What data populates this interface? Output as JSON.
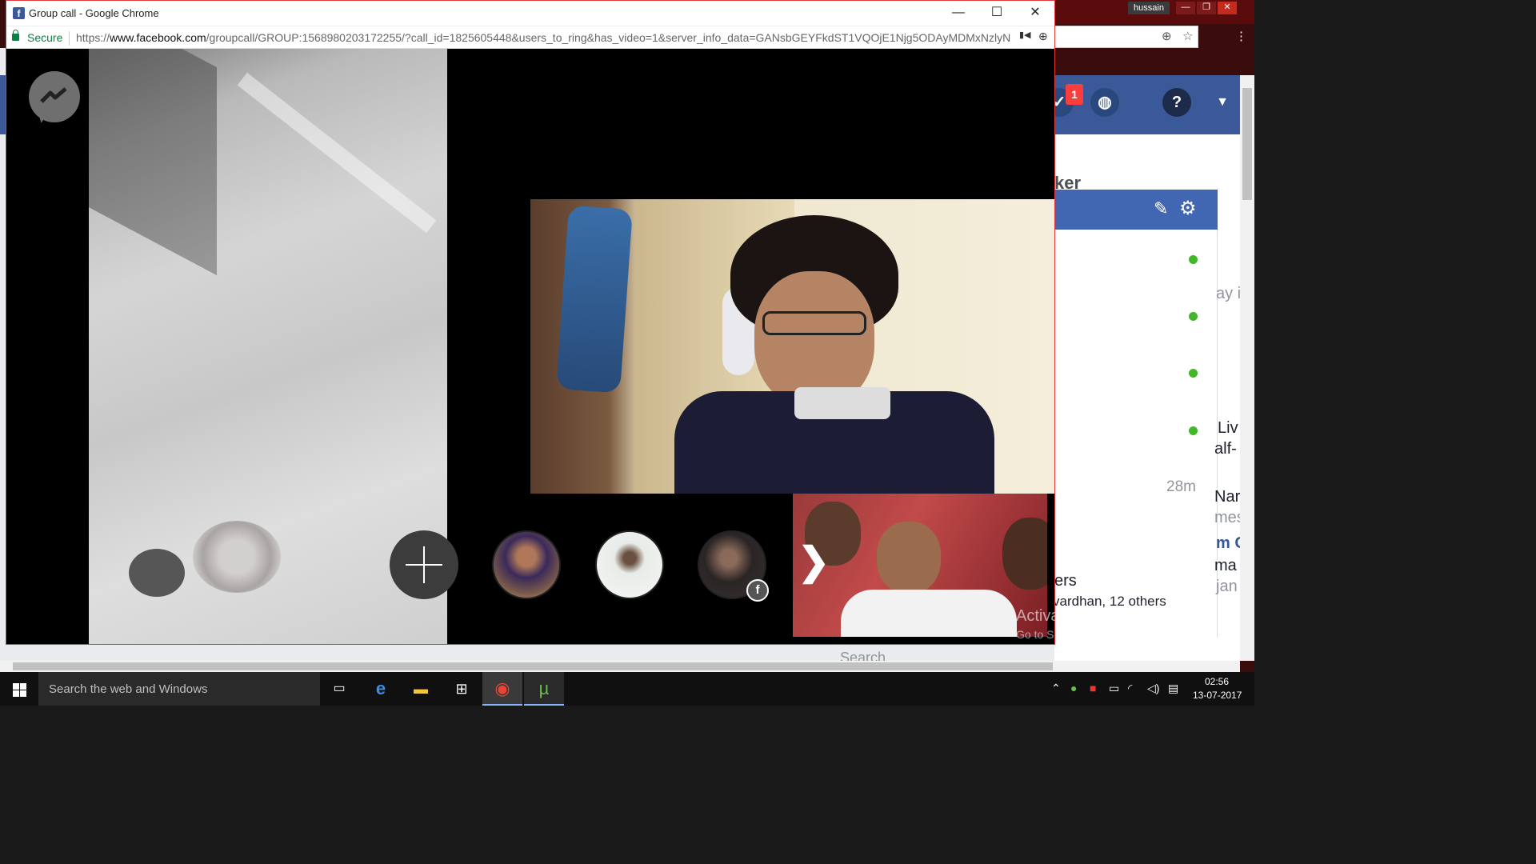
{
  "window": {
    "title": "Group call - Google Chrome",
    "favicon_letter": "f",
    "controls": {
      "minimize": "—",
      "maximize": "☐",
      "close": "✕"
    }
  },
  "address_bar": {
    "secure_label": "Secure",
    "url_scheme": "https://",
    "url_domain": "www.facebook.com",
    "url_path": "/groupcall/GROUP:1568980203172255/?call_id=1825605448&users_to_ring&has_video=1&server_info_data=GANsbGEYFkdST1VQOjE1Njg5ODAyMDMxNzlyN",
    "camera_icon": "▮◀",
    "zoom_icon": "⊕"
  },
  "call": {
    "add_participant_label": "+",
    "participants_fb_badge": "f",
    "next_arrow": "❯",
    "watermark_title": "Activate Windows",
    "watermark_sub": "Go to Settings to activate Windows."
  },
  "background_page": {
    "user_name": "hussain",
    "notification_count": "1",
    "help_icon": "?",
    "ticker_fragment": "ker",
    "snippet_1": "ay i",
    "snippet_2": "Liv",
    "snippet_3": "alf-",
    "time_ago": "28m",
    "snippet_4": "Nar",
    "snippet_5": "mes",
    "snippet_6": "m C",
    "snippet_7": "ma",
    "snippet_8": "jan",
    "snippet_9": "ers",
    "snippet_10": "vardhan, 12 others",
    "search_label": "Search"
  },
  "taskbar": {
    "search_placeholder": "Search the web and Windows",
    "time": "02:56",
    "date": "13-07-2017"
  }
}
